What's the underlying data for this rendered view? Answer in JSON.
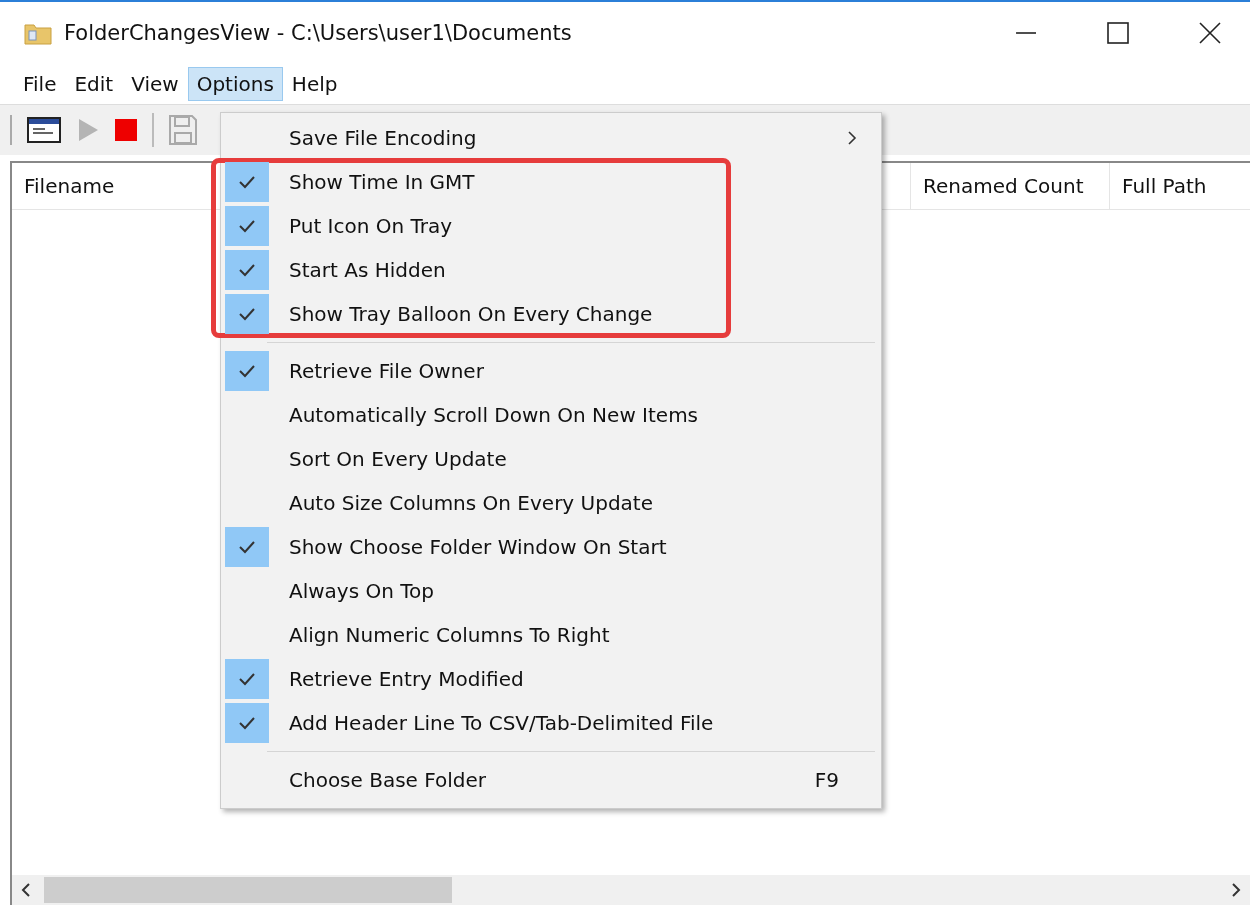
{
  "window": {
    "title": "FolderChangesView  -  C:\\Users\\user1\\Documents"
  },
  "menu_bar": [
    {
      "label": "File",
      "selected": false
    },
    {
      "label": "Edit",
      "selected": false
    },
    {
      "label": "View",
      "selected": false
    },
    {
      "label": "Options",
      "selected": true
    },
    {
      "label": "Help",
      "selected": false
    }
  ],
  "toolbar": [
    {
      "kind": "window",
      "disabled": false
    },
    {
      "kind": "play",
      "disabled": true
    },
    {
      "kind": "stop",
      "disabled": false
    },
    {
      "kind": "separator"
    },
    {
      "kind": "save",
      "disabled": true
    }
  ],
  "table": {
    "columns": [
      "Filename",
      "Renamed Count",
      "Full Path"
    ]
  },
  "options_menu": {
    "sections": [
      {
        "divider": false,
        "highlighted": false,
        "items": [
          {
            "kind": "submenu",
            "label": "Save File Encoding",
            "checked": false
          }
        ]
      },
      {
        "divider": false,
        "highlighted": true,
        "items": [
          {
            "kind": "item",
            "label": "Show Time In GMT",
            "checked": true
          },
          {
            "kind": "item",
            "label": "Put Icon On Tray",
            "checked": true
          },
          {
            "kind": "item",
            "label": "Start As Hidden",
            "checked": true
          },
          {
            "kind": "item",
            "label": "Show Tray Balloon On Every Change",
            "checked": true
          }
        ]
      },
      {
        "divider": true,
        "highlighted": false,
        "items": [
          {
            "kind": "item",
            "label": "Retrieve File Owner",
            "checked": true
          },
          {
            "kind": "item",
            "label": "Automatically Scroll Down On New Items",
            "checked": false
          },
          {
            "kind": "item",
            "label": "Sort On Every Update",
            "checked": false
          },
          {
            "kind": "item",
            "label": "Auto Size Columns On Every Update",
            "checked": false
          },
          {
            "kind": "item",
            "label": "Show Choose Folder Window On Start",
            "checked": true
          },
          {
            "kind": "item",
            "label": "Always On Top",
            "checked": false
          },
          {
            "kind": "item",
            "label": "Align Numeric Columns To Right",
            "checked": false
          },
          {
            "kind": "item",
            "label": "Retrieve Entry Modified",
            "checked": true
          },
          {
            "kind": "item",
            "label": "Add Header Line To CSV/Tab-Delimited File",
            "checked": true
          }
        ]
      },
      {
        "divider": true,
        "highlighted": false,
        "items": [
          {
            "kind": "shortcut",
            "label": "Choose Base Folder",
            "shortcut": "F9",
            "checked": false
          }
        ]
      }
    ]
  }
}
